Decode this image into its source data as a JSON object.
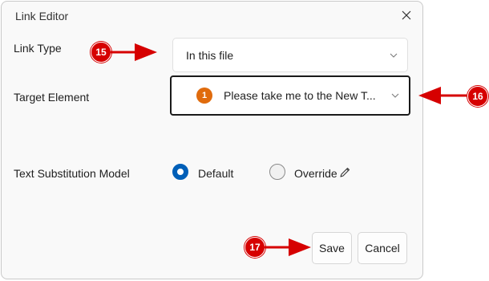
{
  "dialog": {
    "title": "Link Editor",
    "close_icon": "close-icon"
  },
  "link_type": {
    "label": "Link Type",
    "value": "In this file"
  },
  "target_element": {
    "label": "Target Element",
    "badge": "1",
    "value": "Please take me to the New T..."
  },
  "text_substitution": {
    "label": "Text Substitution Model",
    "options": [
      {
        "label": "Default",
        "selected": true
      },
      {
        "label": "Override",
        "selected": false,
        "icon": "pencil-icon"
      }
    ]
  },
  "buttons": {
    "save": "Save",
    "cancel": "Cancel"
  },
  "callouts": [
    "15",
    "16",
    "17"
  ],
  "colors": {
    "accent": "#005fb8",
    "badge": "#e06b0d",
    "callout": "#d60000"
  }
}
